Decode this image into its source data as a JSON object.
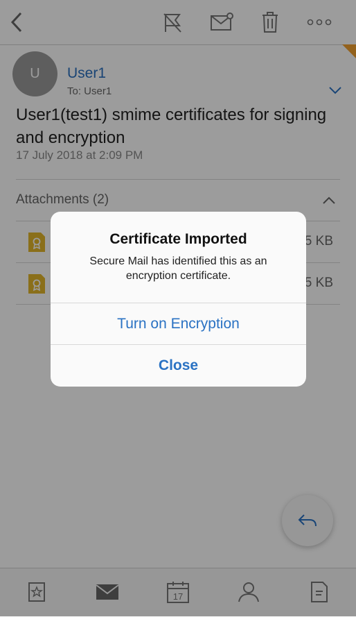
{
  "toolbar": {
    "icons": [
      "back-icon",
      "flag-icon",
      "mark-unread-icon",
      "trash-icon",
      "more-icon"
    ]
  },
  "message": {
    "avatar_initial": "U",
    "sender": "User1",
    "to_line": "To: User1",
    "subject": "User1(test1) smime certificates for signing and encryption",
    "date": "17 July 2018 at 2:09 PM"
  },
  "attachments": {
    "header": "Attachments (2)",
    "items": [
      {
        "icon": "certificate-file-icon",
        "size_visible": "5 KB"
      },
      {
        "icon": "certificate-file-icon",
        "size_visible": "5 KB"
      }
    ]
  },
  "dialog": {
    "title": "Certificate Imported",
    "message": "Secure Mail has identified this as an encryption certificate.",
    "primary_button": "Turn on Encryption",
    "close_button": "Close"
  },
  "tabbar": {
    "calendar_day": "17",
    "icons": [
      "favorites-icon",
      "mail-icon",
      "calendar-icon",
      "contacts-icon",
      "notes-icon"
    ]
  },
  "colors": {
    "accent": "#2a72c3",
    "sender": "#2a6fbf",
    "overlay": "rgba(0,0,0,0.39)",
    "attachment_icon": "#e2b62b",
    "corner_flag": "#f0a030"
  }
}
